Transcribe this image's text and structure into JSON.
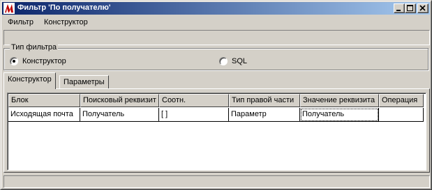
{
  "window": {
    "title": "Фильтр 'По получателю'"
  },
  "menu": {
    "items": [
      {
        "label": "Фильтр"
      },
      {
        "label": "Конструктор"
      }
    ]
  },
  "filter_type": {
    "legend": "Тип фильтра",
    "options": [
      {
        "label": "Конструктор",
        "selected": true
      },
      {
        "label": "SQL",
        "selected": false
      }
    ]
  },
  "tabs": [
    {
      "label": "Конструктор",
      "active": true
    },
    {
      "label": "Параметры",
      "active": false
    }
  ],
  "grid": {
    "columns": [
      "Блок",
      "Поисковый реквизит",
      "Соотн.",
      "Тип правой части",
      "Значение реквизита",
      "Операция"
    ],
    "rows": [
      [
        "Исходящая почта",
        "Получатель",
        "[ ]",
        "Параметр",
        "Получатель",
        ""
      ]
    ]
  },
  "colors": {
    "title_start": "#0a246a",
    "title_end": "#a6caf0",
    "face": "#d4d0c8"
  }
}
